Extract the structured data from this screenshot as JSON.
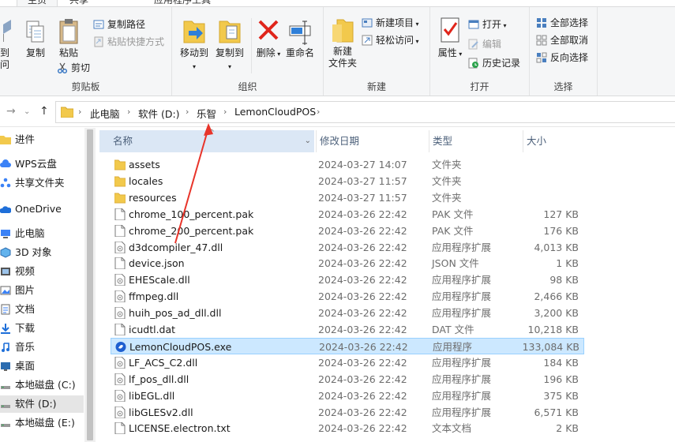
{
  "tabs": [
    "主页",
    "共享",
    "应用程序工具"
  ],
  "ribbon": {
    "clipboard": {
      "pin_label_1": "到",
      "pin_label_2": "问",
      "copy": "复制",
      "paste": "粘贴",
      "copy_path": "复制路径",
      "paste_shortcut": "粘贴快捷方式",
      "cut": "剪切",
      "group": "剪贴板"
    },
    "organize": {
      "move_to": "移动到",
      "copy_to": "复制到",
      "delete": "删除",
      "rename": "重命名",
      "group": "组织"
    },
    "new": {
      "new_folder_1": "新建",
      "new_folder_2": "文件夹",
      "new_item": "新建项目",
      "easy_access": "轻松访问",
      "group": "新建"
    },
    "open": {
      "properties": "属性",
      "open": "打开",
      "edit": "编辑",
      "history": "历史记录",
      "group": "打开"
    },
    "select": {
      "select_all": "全部选择",
      "select_none": "全部取消",
      "invert": "反向选择",
      "group": "选择"
    }
  },
  "address": {
    "crumbs": [
      "此电脑",
      "软件 (D:)",
      "乐智",
      "LemonCloudPOS"
    ]
  },
  "nav": [
    {
      "label": "进件",
      "icon": "folder-icon"
    },
    {
      "label": "WPS云盘",
      "icon": "cloud-icon"
    },
    {
      "label": "共享文件夹",
      "icon": "shared-folder-icon"
    },
    {
      "label": "OneDrive",
      "icon": "onedrive-icon"
    },
    {
      "label": "此电脑",
      "icon": "computer-icon"
    },
    {
      "label": "3D 对象",
      "icon": "cube-icon"
    },
    {
      "label": "视频",
      "icon": "video-icon"
    },
    {
      "label": "图片",
      "icon": "picture-icon"
    },
    {
      "label": "文档",
      "icon": "document-icon"
    },
    {
      "label": "下载",
      "icon": "download-icon"
    },
    {
      "label": "音乐",
      "icon": "music-icon"
    },
    {
      "label": "桌面",
      "icon": "desktop-icon"
    },
    {
      "label": "本地磁盘 (C:)",
      "icon": "drive-icon"
    },
    {
      "label": "软件 (D:)",
      "icon": "drive-icon",
      "selected": true
    },
    {
      "label": "本地磁盘 (E:)",
      "icon": "drive-icon"
    }
  ],
  "columns": {
    "name": "名称",
    "date": "修改日期",
    "type": "类型",
    "size": "大小"
  },
  "files": [
    {
      "name": "assets",
      "date": "2024-03-27 14:07",
      "type": "文件夹",
      "size": "",
      "kind": "folder"
    },
    {
      "name": "locales",
      "date": "2024-03-27 11:57",
      "type": "文件夹",
      "size": "",
      "kind": "folder"
    },
    {
      "name": "resources",
      "date": "2024-03-27 11:57",
      "type": "文件夹",
      "size": "",
      "kind": "folder"
    },
    {
      "name": "chrome_100_percent.pak",
      "date": "2024-03-26 22:42",
      "type": "PAK 文件",
      "size": "127 KB",
      "kind": "file"
    },
    {
      "name": "chrome_200_percent.pak",
      "date": "2024-03-26 22:42",
      "type": "PAK 文件",
      "size": "176 KB",
      "kind": "file"
    },
    {
      "name": "d3dcompiler_47.dll",
      "date": "2024-03-26 22:42",
      "type": "应用程序扩展",
      "size": "4,013 KB",
      "kind": "dll"
    },
    {
      "name": "device.json",
      "date": "2024-03-26 22:42",
      "type": "JSON 文件",
      "size": "1 KB",
      "kind": "file"
    },
    {
      "name": "EHEScale.dll",
      "date": "2024-03-26 22:42",
      "type": "应用程序扩展",
      "size": "98 KB",
      "kind": "dll"
    },
    {
      "name": "ffmpeg.dll",
      "date": "2024-03-26 22:42",
      "type": "应用程序扩展",
      "size": "2,466 KB",
      "kind": "dll"
    },
    {
      "name": "huih_pos_ad_dll.dll",
      "date": "2024-03-26 22:42",
      "type": "应用程序扩展",
      "size": "3,200 KB",
      "kind": "dll"
    },
    {
      "name": "icudtl.dat",
      "date": "2024-03-26 22:42",
      "type": "DAT 文件",
      "size": "10,218 KB",
      "kind": "file"
    },
    {
      "name": "LemonCloudPOS.exe",
      "date": "2024-03-26 22:42",
      "type": "应用程序",
      "size": "133,084 KB",
      "kind": "exe",
      "selected": true
    },
    {
      "name": "LF_ACS_C2.dll",
      "date": "2024-03-26 22:42",
      "type": "应用程序扩展",
      "size": "184 KB",
      "kind": "dll"
    },
    {
      "name": "lf_pos_dll.dll",
      "date": "2024-03-26 22:42",
      "type": "应用程序扩展",
      "size": "196 KB",
      "kind": "dll"
    },
    {
      "name": "libEGL.dll",
      "date": "2024-03-26 22:42",
      "type": "应用程序扩展",
      "size": "375 KB",
      "kind": "dll"
    },
    {
      "name": "libGLESv2.dll",
      "date": "2024-03-26 22:42",
      "type": "应用程序扩展",
      "size": "6,571 KB",
      "kind": "dll"
    },
    {
      "name": "LICENSE.electron.txt",
      "date": "2024-03-26 22:42",
      "type": "文本文档",
      "size": "2 KB",
      "kind": "file"
    }
  ],
  "colors": {
    "annotation_arrow": "#e8342a",
    "selection": "#cce8ff",
    "accent": "#1e6fd9"
  }
}
